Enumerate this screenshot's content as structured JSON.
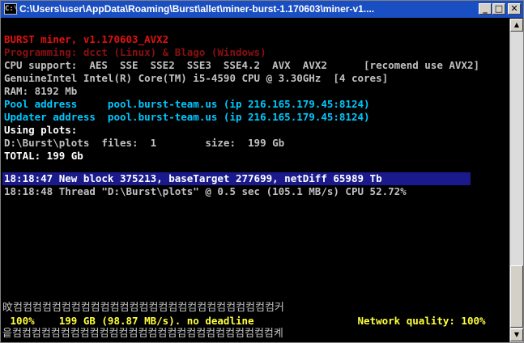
{
  "window": {
    "title": "C:\\Users\\user\\AppData\\Roaming\\Burst\\allet\\miner-burst-1.170603\\miner-v1....",
    "icon_label": "C:\\",
    "minimize_glyph": "_",
    "maximize_glyph": "□",
    "close_glyph": "✕"
  },
  "console": {
    "header": {
      "title": "BURST miner, v1.170603_AVX2",
      "programming": "Programming: dcct (Linux) & Blago (Windows)"
    },
    "cpu_support": "CPU support:  AES  SSE  SSE2  SSE3  SSE4.2  AVX  AVX2      [recomend use AVX2]",
    "cpu_info": "GenuineIntel Intel(R) Core(TM) i5-4590 CPU @ 3.30GHz  [4 cores]",
    "ram": "RAM: 8192 Mb",
    "pool_address": "Pool address     pool.burst-team.us (ip 216.165.179.45:8124)",
    "updater_address": "Updater address  pool.burst-team.us (ip 216.165.179.45:8124)",
    "using_plots": "Using plots:",
    "plot_dir": "D:\\Burst\\plots  files:  1        size:  199 Gb",
    "total": "TOTAL: 199 Gb",
    "log": [
      "18:18:47 New block 375213, baseTarget 277699, netDiff 65989 Tb",
      "18:18:48 Thread \"D:\\Burst\\plots\" @ 0.5 sec (105.1 MB/s) CPU 52.72%"
    ],
    "box_top": "旼컴컴컴컴컴컴컴컴컴컴컴컴컴컴컴컴컴컴컴컴컴컴컴컴컴컴컴커",
    "status": " 100%    199 GB (98.87 MB/s). no deadline                 Network quality: 100%",
    "box_bottom": "읕컴컴컴컴컴컴컴컴컴컴컴컴컴컴컴컴컴컴컴컴컴컴컴컴컴컴컴켸"
  },
  "scrollbar": {
    "up_glyph": "▲",
    "down_glyph": "▼"
  },
  "colors": {
    "titlebar": "#1a4fc4",
    "highlight": "#1a1a8c",
    "cyan": "#00c8ff",
    "red": "#e01010",
    "yellow": "#ffff3c"
  }
}
